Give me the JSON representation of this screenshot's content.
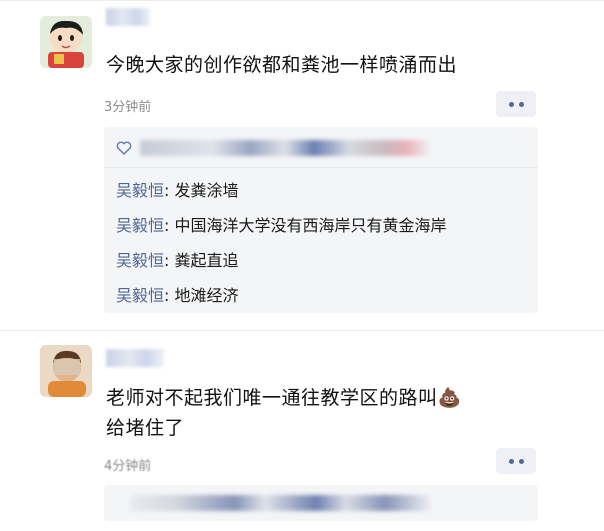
{
  "post1": {
    "content": "今晚大家的创作欲都和粪池一样喷涌而出",
    "time": "3分钟前",
    "likes_icon": "heart-icon",
    "comments": [
      {
        "name": "吴毅恒",
        "sep": ": ",
        "text": "发粪涂墙"
      },
      {
        "name": "吴毅恒",
        "sep": ": ",
        "text": "中国海洋大学没有西海岸只有黄金海岸"
      },
      {
        "name": "吴毅恒",
        "sep": ": ",
        "text": "粪起直追"
      },
      {
        "name": "吴毅恒",
        "sep": ": ",
        "text": "地滩经济"
      }
    ]
  },
  "post2": {
    "content_line1": "老师对不起我们唯一通往教学区的路叫",
    "content_emoji": "💩",
    "content_line2": "给堵住了",
    "time": "4分钟前"
  },
  "colors": {
    "name_link": "#4d6594",
    "time_gray": "#8c8c8c",
    "box_bg": "#f4f5f7"
  }
}
